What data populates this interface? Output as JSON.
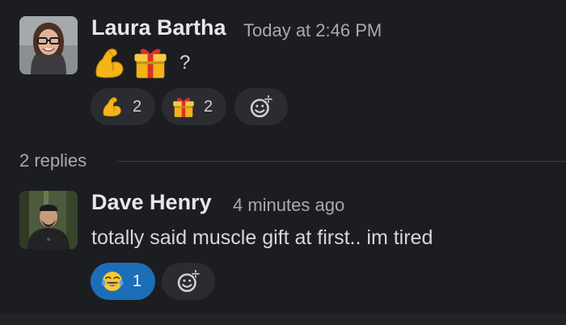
{
  "message": {
    "author": "Laura Bartha",
    "timestamp": "Today at 2:46 PM",
    "body_emojis": [
      "flexed-biceps",
      "wrapped-gift"
    ],
    "body_suffix": "?",
    "reactions": [
      {
        "emoji": "flexed-biceps",
        "count": "2"
      },
      {
        "emoji": "wrapped-gift",
        "count": "2"
      }
    ],
    "add_reaction_icon": "add-reaction-icon"
  },
  "thread": {
    "replies_label": "2 replies"
  },
  "reply": {
    "author": "Dave Henry",
    "timestamp": "4 minutes ago",
    "text": "totally said muscle gift at first.. im tired",
    "reactions": [
      {
        "emoji": "joy",
        "count": "1",
        "active": true
      }
    ],
    "add_reaction_icon": "add-reaction-icon"
  },
  "colors": {
    "background": "#1c1d21",
    "reaction_bg": "#2b2c31",
    "reaction_active_bg": "#1d6eb8",
    "muted_text": "#a9aaad"
  }
}
